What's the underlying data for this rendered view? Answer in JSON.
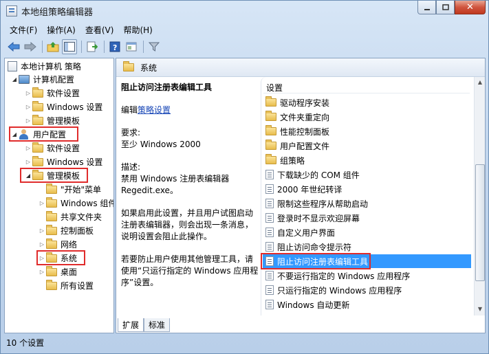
{
  "window": {
    "title": "本地组策略编辑器"
  },
  "menu": [
    "文件(F)",
    "操作(A)",
    "查看(V)",
    "帮助(H)"
  ],
  "tree": {
    "root": "本地计算机 策略",
    "computer_config": "计算机配置",
    "cc_software": "软件设置",
    "cc_windows": "Windows 设置",
    "cc_admin": "管理模板",
    "user_config": "用户配置",
    "uc_software": "软件设置",
    "uc_windows": "Windows 设置",
    "uc_admin": "管理模板",
    "start_menu": "\"开始\"菜单",
    "windows_components": "Windows 组件",
    "shared_folders": "共享文件夹",
    "control_panel": "控制面板",
    "network": "网络",
    "system": "系统",
    "desktop": "桌面",
    "all_settings": "所有设置"
  },
  "right": {
    "header": "系统",
    "detail": {
      "title": "阻止访问注册表编辑工具",
      "edit_prefix": "编辑",
      "edit_link": "策略设置",
      "requirement_label": "要求:",
      "requirement_value": "至少 Windows 2000",
      "description_label": "描述:",
      "description_1": "禁用 Windows 注册表编辑器",
      "description_2": "Regedit.exe。",
      "para_1": "如果启用此设置，并且用户试图启动注册表编辑器，则会出现一条消息，说明设置会阻止此操作。",
      "para_2": "若要防止用户使用其他管理工具，请使用“只运行指定的 Windows 应用程序”设置。"
    },
    "column_header": "设置",
    "items": [
      {
        "label": "驱动程序安装",
        "icon": "folder-icon"
      },
      {
        "label": "文件夹重定向",
        "icon": "folder-icon"
      },
      {
        "label": "性能控制面板",
        "icon": "folder-icon"
      },
      {
        "label": "用户配置文件",
        "icon": "folder-icon"
      },
      {
        "label": "组策略",
        "icon": "folder-icon"
      },
      {
        "label": "下载缺少的 COM 组件",
        "icon": "policy-setting-icon"
      },
      {
        "label": "2000 年世纪转译",
        "icon": "policy-setting-icon"
      },
      {
        "label": "限制这些程序从帮助启动",
        "icon": "policy-setting-icon"
      },
      {
        "label": "登录时不显示欢迎屏幕",
        "icon": "policy-setting-icon"
      },
      {
        "label": "自定义用户界面",
        "icon": "policy-setting-icon"
      },
      {
        "label": "阻止访问命令提示符",
        "icon": "policy-setting-icon"
      },
      {
        "label": "阻止访问注册表编辑工具",
        "icon": "policy-setting-icon",
        "selected": true
      },
      {
        "label": "不要运行指定的 Windows 应用程序",
        "icon": "policy-setting-icon"
      },
      {
        "label": "只运行指定的 Windows 应用程序",
        "icon": "policy-setting-icon"
      },
      {
        "label": "Windows 自动更新",
        "icon": "policy-setting-icon"
      }
    ],
    "tabs": [
      "扩展",
      "标准"
    ]
  },
  "status": "10 个设置",
  "colors": {
    "highlight": "#3399ff",
    "annotation": "#e02b2b",
    "link": "#1645b6"
  }
}
